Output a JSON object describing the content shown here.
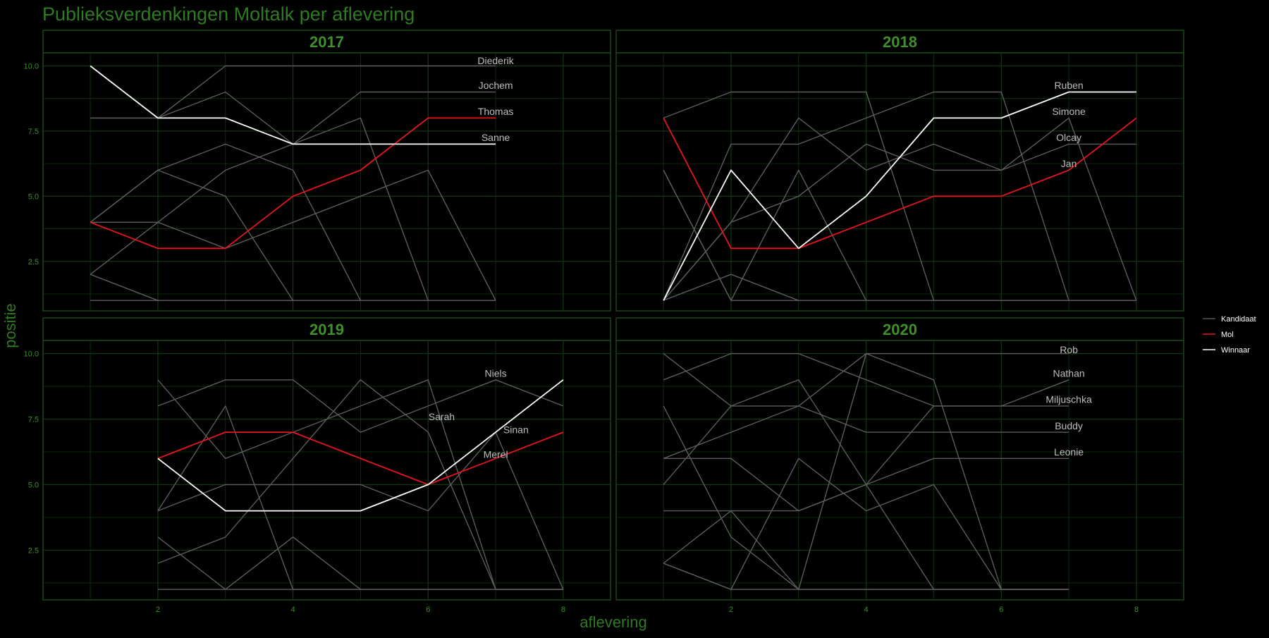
{
  "chart_data": {
    "type": "line",
    "title": "Publieksverdenkingen Moltalk per aflevering",
    "xlabel": "aflevering",
    "ylabel": "positie",
    "xticks": [
      2,
      4,
      6,
      8
    ],
    "yticks": [
      2.5,
      5.0,
      7.5,
      10.0
    ],
    "ytick_labels": [
      "2.5",
      "5.0",
      "7.5",
      "10.0"
    ],
    "xlim": [
      0.3,
      8.7
    ],
    "ylim": [
      0.6,
      10.5
    ],
    "grid": true,
    "legend_position": "right",
    "legend": [
      {
        "name": "Kandidaat",
        "color": "#555555"
      },
      {
        "name": "Mol",
        "color": "#e8141c"
      },
      {
        "name": "Winnaar",
        "color": "#ffffff"
      }
    ],
    "colors": {
      "background": "#000000",
      "panel_border": "#1f5a1f",
      "grid": "#123512",
      "accent_text": "#3f8f2a",
      "label": "#bdbdbd"
    },
    "facets": [
      {
        "title": "2017",
        "series": [
          {
            "role": "Kandidaat",
            "label": "Diederik",
            "x": [
              1,
              2,
              3,
              4,
              5,
              6,
              7
            ],
            "y": [
              8,
              8,
              10,
              10,
              10,
              10,
              10
            ]
          },
          {
            "role": "Kandidaat",
            "label": "Jochem",
            "x": [
              1,
              2,
              3,
              4,
              5,
              6,
              7
            ],
            "y": [
              8,
              8,
              9,
              7,
              9,
              9,
              9
            ]
          },
          {
            "role": "Mol",
            "label": "Thomas",
            "x": [
              1,
              2,
              3,
              4,
              5,
              6,
              7
            ],
            "y": [
              4,
              3,
              3,
              5,
              6,
              8,
              8
            ]
          },
          {
            "role": "Winnaar",
            "label": "Sanne",
            "x": [
              1,
              2,
              3,
              4,
              5,
              6,
              7
            ],
            "y": [
              10,
              8,
              8,
              7,
              7,
              7,
              7
            ]
          },
          {
            "x": [
              1,
              2,
              3,
              4,
              5
            ],
            "y": [
              4,
              6,
              7,
              6,
              1
            ]
          },
          {
            "x": [
              1,
              2,
              3,
              4,
              5,
              6,
              7
            ],
            "y": [
              2,
              1,
              1,
              1,
              1,
              1,
              1
            ]
          },
          {
            "x": [
              1,
              2,
              3,
              4,
              5,
              6
            ],
            "y": [
              4,
              4,
              3,
              4,
              5,
              6
            ]
          },
          {
            "x": [
              1,
              2,
              3,
              4
            ],
            "y": [
              2,
              4,
              6,
              7
            ]
          },
          {
            "x": [
              1,
              2,
              3,
              4
            ],
            "y": [
              4,
              6,
              5,
              1
            ]
          },
          {
            "x": [
              4,
              5,
              6
            ],
            "y": [
              7,
              8,
              1
            ]
          },
          {
            "x": [
              6,
              7
            ],
            "y": [
              6,
              1
            ]
          },
          {
            "x": [
              1,
              2,
              3,
              4,
              5,
              6,
              7
            ],
            "y": [
              1,
              1,
              1,
              1,
              1,
              1,
              1
            ]
          }
        ],
        "labels": [
          {
            "text": "Diederik",
            "x": 7,
            "y": 10.2
          },
          {
            "text": "Jochem",
            "x": 7,
            "y": 9.25
          },
          {
            "text": "Thomas",
            "x": 7,
            "y": 8.25
          },
          {
            "text": "Sanne",
            "x": 7,
            "y": 7.25
          }
        ]
      },
      {
        "title": "2018",
        "series": [
          {
            "role": "Kandidaat",
            "label": "Simone",
            "x": [
              1,
              2,
              3,
              4,
              5,
              6,
              7,
              8
            ],
            "y": [
              8,
              9,
              9,
              9,
              1,
              1,
              1,
              1
            ]
          },
          {
            "role": "Kandidaat",
            "label": "Olcay",
            "x": [
              1,
              2,
              3,
              4,
              5,
              6,
              7,
              8
            ],
            "y": [
              1,
              7,
              7,
              8,
              9,
              9,
              1,
              1
            ]
          },
          {
            "role": "Mol",
            "label": "Jan",
            "x": [
              1,
              2,
              3,
              4,
              5,
              6,
              7,
              8
            ],
            "y": [
              8,
              3,
              3,
              4,
              5,
              5,
              6,
              8
            ]
          },
          {
            "role": "Winnaar",
            "label": "Ruben",
            "x": [
              1,
              2,
              3,
              4,
              5,
              6,
              7,
              8
            ],
            "y": [
              1,
              6,
              3,
              5,
              8,
              8,
              9,
              9
            ]
          },
          {
            "x": [
              1,
              2,
              3,
              4,
              5,
              6,
              7,
              8
            ],
            "y": [
              1,
              4,
              5,
              7,
              6,
              6,
              8,
              1
            ]
          },
          {
            "x": [
              1,
              2,
              3,
              4,
              5,
              6,
              7,
              8
            ],
            "y": [
              1,
              4,
              8,
              6,
              7,
              6,
              7,
              7
            ]
          },
          {
            "x": [
              1,
              2,
              3,
              4
            ],
            "y": [
              6,
              1,
              6,
              1
            ]
          },
          {
            "x": [
              1,
              2,
              3,
              4,
              5,
              6,
              7,
              8
            ],
            "y": [
              6,
              1,
              1,
              1,
              1,
              1,
              1,
              1
            ]
          },
          {
            "x": [
              1,
              2,
              3,
              4,
              5,
              6,
              7,
              8
            ],
            "y": [
              1,
              2,
              1,
              1,
              1,
              1,
              1,
              1
            ]
          }
        ],
        "labels": [
          {
            "text": "Ruben",
            "x": 7,
            "y": 9.25
          },
          {
            "text": "Simone",
            "x": 7,
            "y": 8.25
          },
          {
            "text": "Olcay",
            "x": 7,
            "y": 7.25
          },
          {
            "text": "Jan",
            "x": 7,
            "y": 6.25
          }
        ]
      },
      {
        "title": "2019",
        "series": [
          {
            "role": "Kandidaat",
            "label": "Niels",
            "x": [
              2,
              3,
              4,
              5,
              6,
              7,
              8
            ],
            "y": [
              8,
              9,
              9,
              7,
              8,
              9,
              8
            ]
          },
          {
            "role": "Kandidaat",
            "label": "Sarah",
            "x": [
              2,
              3,
              4,
              5,
              6,
              7,
              8
            ],
            "y": [
              9,
              6,
              7,
              8,
              9,
              1,
              1
            ]
          },
          {
            "role": "Mol",
            "label": "Merel",
            "x": [
              2,
              3,
              4,
              5,
              6,
              7,
              8
            ],
            "y": [
              6,
              7,
              7,
              6,
              5,
              6,
              7
            ]
          },
          {
            "role": "Winnaar",
            "label": "Sinan",
            "x": [
              2,
              3,
              4,
              5,
              6,
              7,
              8
            ],
            "y": [
              6,
              4,
              4,
              4,
              5,
              7,
              9
            ]
          },
          {
            "x": [
              2,
              3,
              4,
              5,
              6,
              7,
              8
            ],
            "y": [
              4,
              5,
              5,
              5,
              4,
              7,
              1
            ]
          },
          {
            "x": [
              2,
              3,
              4,
              5
            ],
            "y": [
              4,
              8,
              1,
              1
            ]
          },
          {
            "x": [
              2,
              3,
              4,
              5,
              6,
              7,
              8
            ],
            "y": [
              2,
              3,
              6,
              9,
              7,
              1,
              1
            ]
          },
          {
            "x": [
              2,
              3,
              4,
              5,
              6,
              7,
              8
            ],
            "y": [
              3,
              1,
              3,
              1,
              1,
              1,
              1
            ]
          },
          {
            "x": [
              2,
              3,
              4,
              5,
              6,
              7,
              8
            ],
            "y": [
              1,
              1,
              1,
              1,
              1,
              1,
              1
            ]
          }
        ],
        "labels": [
          {
            "text": "Niels",
            "x": 7,
            "y": 9.25
          },
          {
            "text": "Sarah",
            "x": 6.2,
            "y": 7.6
          },
          {
            "text": "Sinan",
            "x": 7.3,
            "y": 7.1
          },
          {
            "text": "Merel",
            "x": 7,
            "y": 6.15
          }
        ]
      },
      {
        "title": "2020",
        "series": [
          {
            "role": "Kandidaat",
            "label": "Rob",
            "x": [
              1,
              2,
              3,
              4,
              5,
              6,
              7
            ],
            "y": [
              5,
              8,
              8,
              10,
              10,
              10,
              10
            ]
          },
          {
            "role": "Kandidaat",
            "label": "Nathan",
            "x": [
              1,
              2,
              3,
              4,
              5,
              6,
              7
            ],
            "y": [
              9,
              10,
              10,
              9,
              8,
              8,
              9
            ]
          },
          {
            "role": "Kandidaat",
            "label": "Miljuschka",
            "x": [
              1,
              2,
              3,
              4,
              5,
              6,
              7
            ],
            "y": [
              6,
              6,
              4,
              5,
              8,
              8,
              8
            ]
          },
          {
            "role": "Kandidaat",
            "label": "Buddy",
            "x": [
              1,
              2,
              3,
              4,
              5,
              6,
              7
            ],
            "y": [
              6,
              7,
              8,
              7,
              7,
              7,
              7
            ]
          },
          {
            "role": "Kandidaat",
            "label": "Leonie",
            "x": [
              1,
              2,
              3,
              4,
              5,
              6,
              7
            ],
            "y": [
              4,
              4,
              4,
              5,
              6,
              6,
              6
            ]
          },
          {
            "x": [
              1,
              2,
              3,
              4,
              5,
              6,
              7
            ],
            "y": [
              10,
              8,
              9,
              5,
              1,
              1,
              1
            ]
          },
          {
            "x": [
              1,
              2,
              3,
              4,
              5,
              6,
              7
            ],
            "y": [
              8,
              3,
              1,
              1,
              1,
              1,
              1
            ]
          },
          {
            "x": [
              1,
              2,
              3,
              4,
              5,
              6,
              7
            ],
            "y": [
              2,
              4,
              1,
              10,
              9,
              1,
              1
            ]
          },
          {
            "x": [
              1,
              2,
              3,
              4,
              5,
              6,
              7
            ],
            "y": [
              2,
              1,
              6,
              4,
              5,
              1,
              1
            ]
          },
          {
            "x": [
              1,
              2,
              3,
              4,
              5,
              6,
              7
            ],
            "y": [
              2,
              1,
              1,
              1,
              1,
              1,
              1
            ]
          }
        ],
        "labels": [
          {
            "text": "Rob",
            "x": 7,
            "y": 10.15
          },
          {
            "text": "Nathan",
            "x": 7,
            "y": 9.25
          },
          {
            "text": "Miljuschka",
            "x": 7,
            "y": 8.25
          },
          {
            "text": "Buddy",
            "x": 7,
            "y": 7.25
          },
          {
            "text": "Leonie",
            "x": 7,
            "y": 6.25
          }
        ]
      }
    ]
  }
}
